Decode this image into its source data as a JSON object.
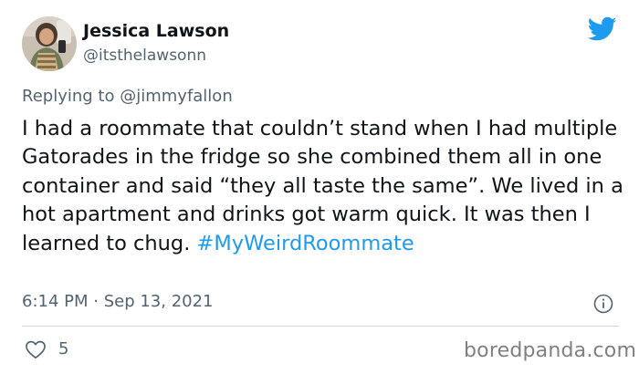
{
  "user": {
    "display_name": "Jessica Lawson",
    "handle": "@itsthelawsonn"
  },
  "reply": {
    "prefix": "Replying to",
    "mention": "@jimmyfallon"
  },
  "tweet": {
    "text": "I had a roommate that couldn’t stand when I had multiple Gatorades in the fridge so she combined them all in one container and said “they all taste the same”. We lived in a hot apartment and drinks got warm quick. It was then I learned to chug.",
    "hashtag": "#MyWeirdRoommate"
  },
  "meta": {
    "timestamp": "6:14 PM · Sep 13, 2021",
    "likes": "5"
  },
  "watermark": "boredpanda.com",
  "colors": {
    "accent": "#1d9bf0",
    "text": "#0f1419",
    "muted": "#536471",
    "divider": "#cfd9de"
  },
  "icons": [
    "twitter-bird-icon",
    "info-icon",
    "heart-icon"
  ]
}
